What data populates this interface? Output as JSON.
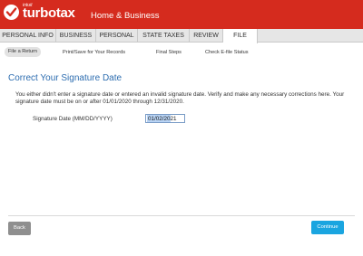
{
  "brand": {
    "intuit": "intuit",
    "product": "turbotax",
    "edition": "Home & Business",
    "color": "#d52b1e",
    "icon": "checkmark-icon"
  },
  "nav": {
    "tabs": [
      {
        "label": "PERSONAL INFO"
      },
      {
        "label": "BUSINESS"
      },
      {
        "label": "PERSONAL"
      },
      {
        "label": "STATE TAXES"
      },
      {
        "label": "REVIEW"
      },
      {
        "label": "FILE"
      }
    ],
    "active_tab": "FILE"
  },
  "subnav": {
    "items": [
      {
        "label": "File a Return"
      },
      {
        "label": "Print/Save for Your Records"
      },
      {
        "label": "Final Steps"
      },
      {
        "label": "Check E-file Status"
      }
    ],
    "active_item": "File a Return"
  },
  "main": {
    "title": "Correct Your Signature Date",
    "title_color": "#2d6db0",
    "instructions": "You either didn't enter a signature date or entered an invalid signature date. Verify and make any necessary corrections here. Your signature date must be on or after 01/01/2020 through 12/31/2020.",
    "date_label": "Signature Date (MM/DD/YYYY)",
    "date_value": "01/02/2021"
  },
  "footer": {
    "back_label": "Back",
    "continue_label": "Continue",
    "continue_color": "#1aa5e0"
  }
}
